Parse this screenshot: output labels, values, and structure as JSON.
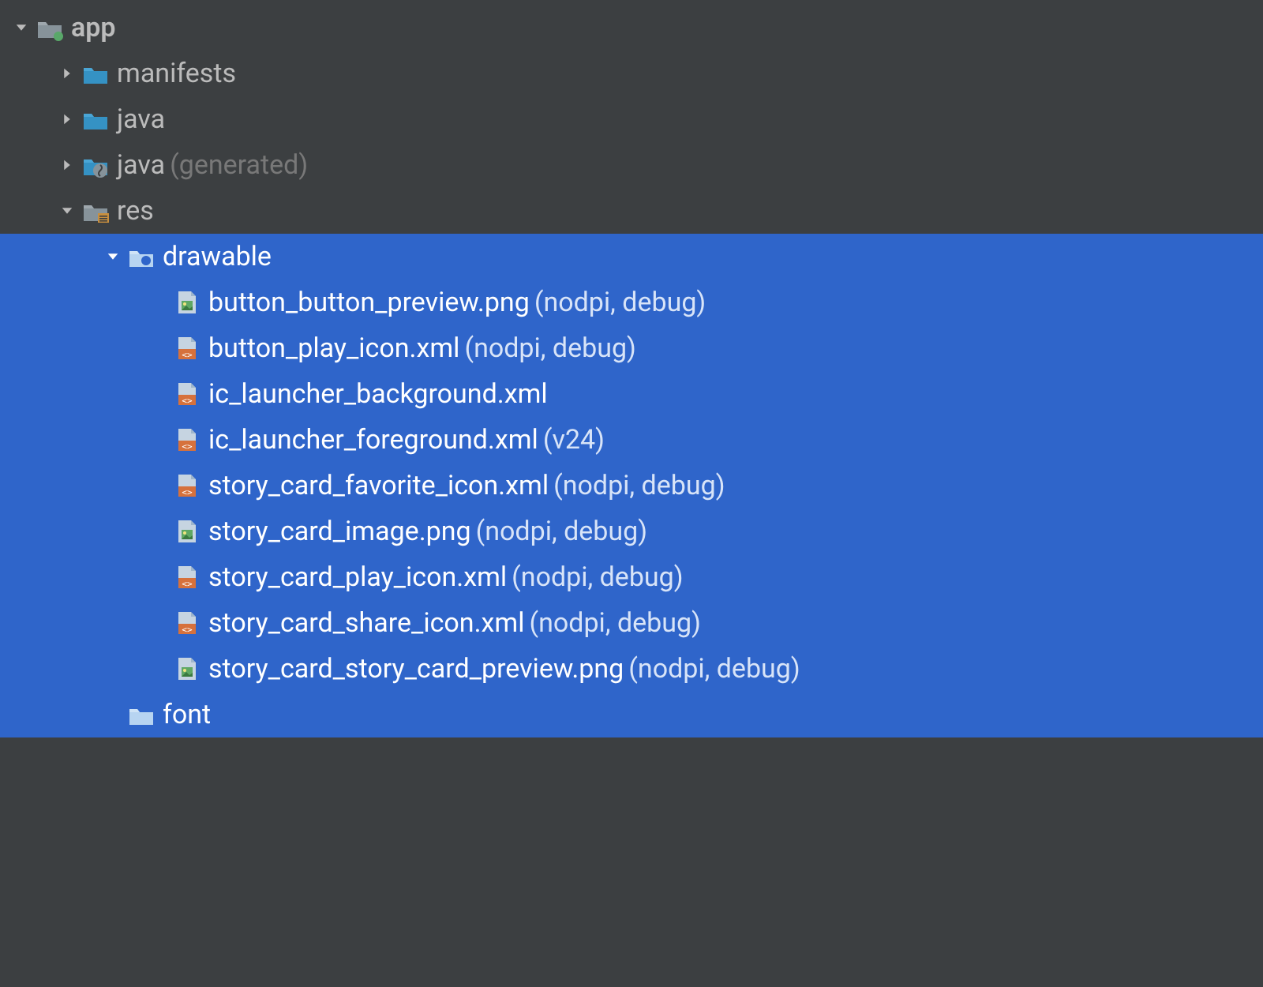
{
  "tree": {
    "app": {
      "label": "app",
      "expanded": true,
      "children": {
        "manifests": {
          "label": "manifests",
          "expanded": false
        },
        "java": {
          "label": "java",
          "expanded": false
        },
        "java_generated": {
          "label": "java",
          "qualifier": "(generated)",
          "expanded": false
        },
        "res": {
          "label": "res",
          "expanded": true,
          "children": {
            "drawable": {
              "label": "drawable",
              "expanded": true,
              "files": [
                {
                  "name": "button_button_preview.png",
                  "qualifier": "(nodpi, debug)",
                  "type": "image"
                },
                {
                  "name": "button_play_icon.xml",
                  "qualifier": "(nodpi, debug)",
                  "type": "xml"
                },
                {
                  "name": "ic_launcher_background.xml",
                  "qualifier": "",
                  "type": "xml"
                },
                {
                  "name": "ic_launcher_foreground.xml",
                  "qualifier": "(v24)",
                  "type": "xml"
                },
                {
                  "name": "story_card_favorite_icon.xml",
                  "qualifier": "(nodpi, debug)",
                  "type": "xml"
                },
                {
                  "name": "story_card_image.png",
                  "qualifier": "(nodpi, debug)",
                  "type": "image"
                },
                {
                  "name": "story_card_play_icon.xml",
                  "qualifier": "(nodpi, debug)",
                  "type": "xml"
                },
                {
                  "name": "story_card_share_icon.xml",
                  "qualifier": "(nodpi, debug)",
                  "type": "xml"
                },
                {
                  "name": "story_card_story_card_preview.png",
                  "qualifier": "(nodpi, debug)",
                  "type": "image"
                }
              ]
            },
            "font": {
              "label": "font"
            }
          }
        }
      }
    }
  }
}
